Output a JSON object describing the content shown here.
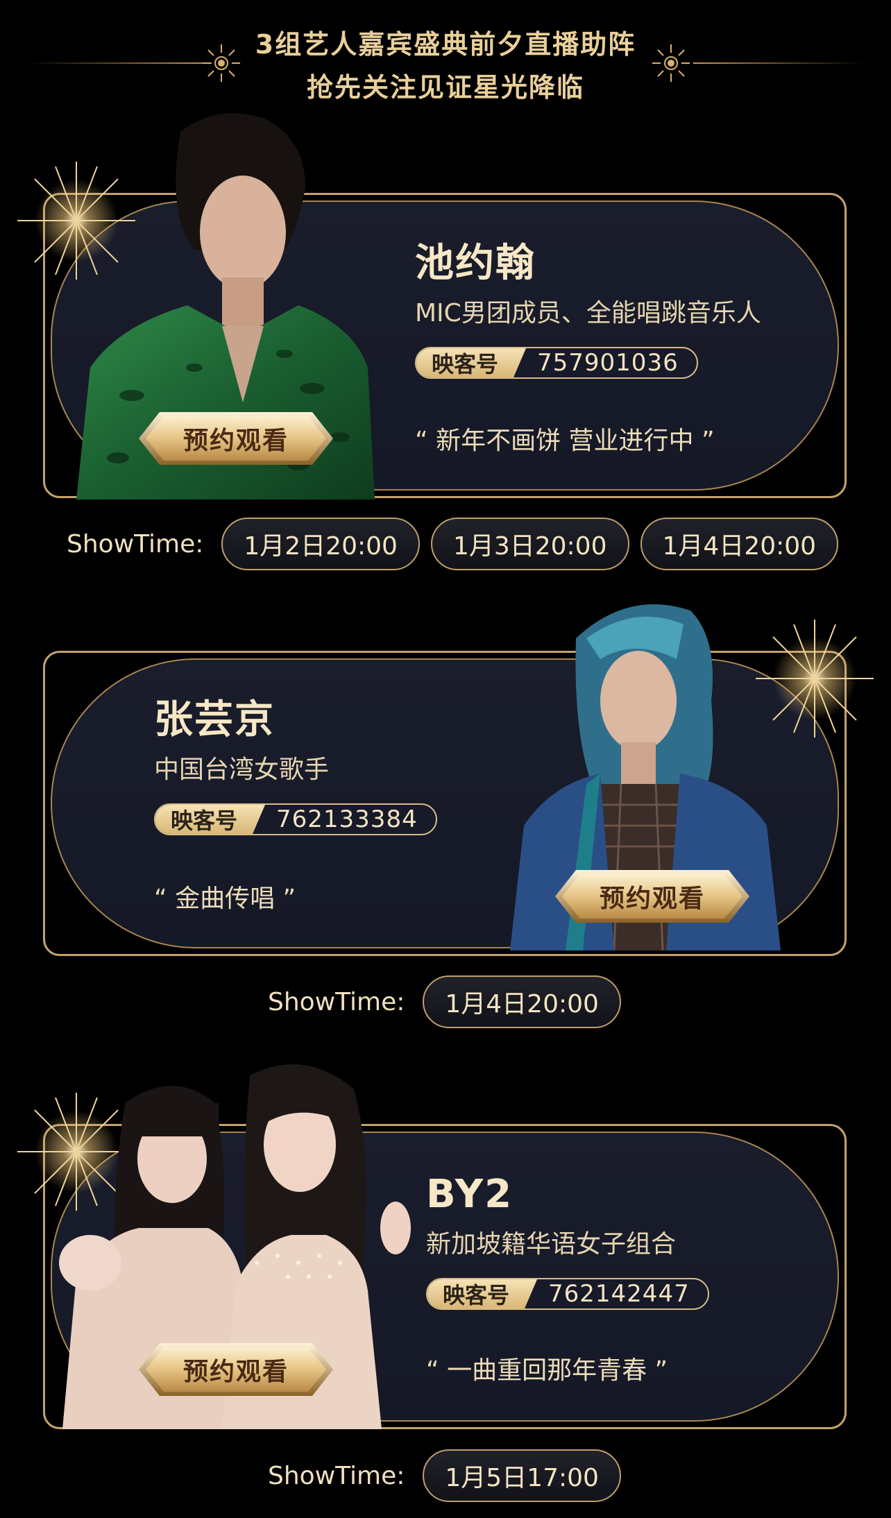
{
  "header": {
    "line1": "3组艺人嘉宾盛典前夕直播助阵",
    "line2": "抢先关注见证星光降临"
  },
  "colors": {
    "gold": "#c3a36c",
    "card_bg": "#1a1d2b",
    "pill_gold": "#d9b777"
  },
  "artists": [
    {
      "name": "池约翰",
      "desc": "MIC男团成员、全能唱跳音乐人",
      "id_label": "映客号",
      "id_value": "757901036",
      "quote": "“ 新年不画饼 营业进行中 ”",
      "button": "预约观看",
      "showtime_label": "ShowTime:",
      "showtimes": [
        "1月2日20:00",
        "1月3日20:00",
        "1月4日20:00"
      ]
    },
    {
      "name": "张芸京",
      "desc": "中国台湾女歌手",
      "id_label": "映客号",
      "id_value": "762133384",
      "quote": "“ 金曲传唱 ”",
      "button": "预约观看",
      "showtime_label": "ShowTime:",
      "showtimes": [
        "1月4日20:00"
      ]
    },
    {
      "name": "BY2",
      "desc": "新加坡籍华语女子组合",
      "id_label": "映客号",
      "id_value": "762142447",
      "quote": "“ 一曲重回那年青春 ”",
      "button": "预约观看",
      "showtime_label": "ShowTime:",
      "showtimes": [
        "1月5日17:00"
      ]
    }
  ]
}
